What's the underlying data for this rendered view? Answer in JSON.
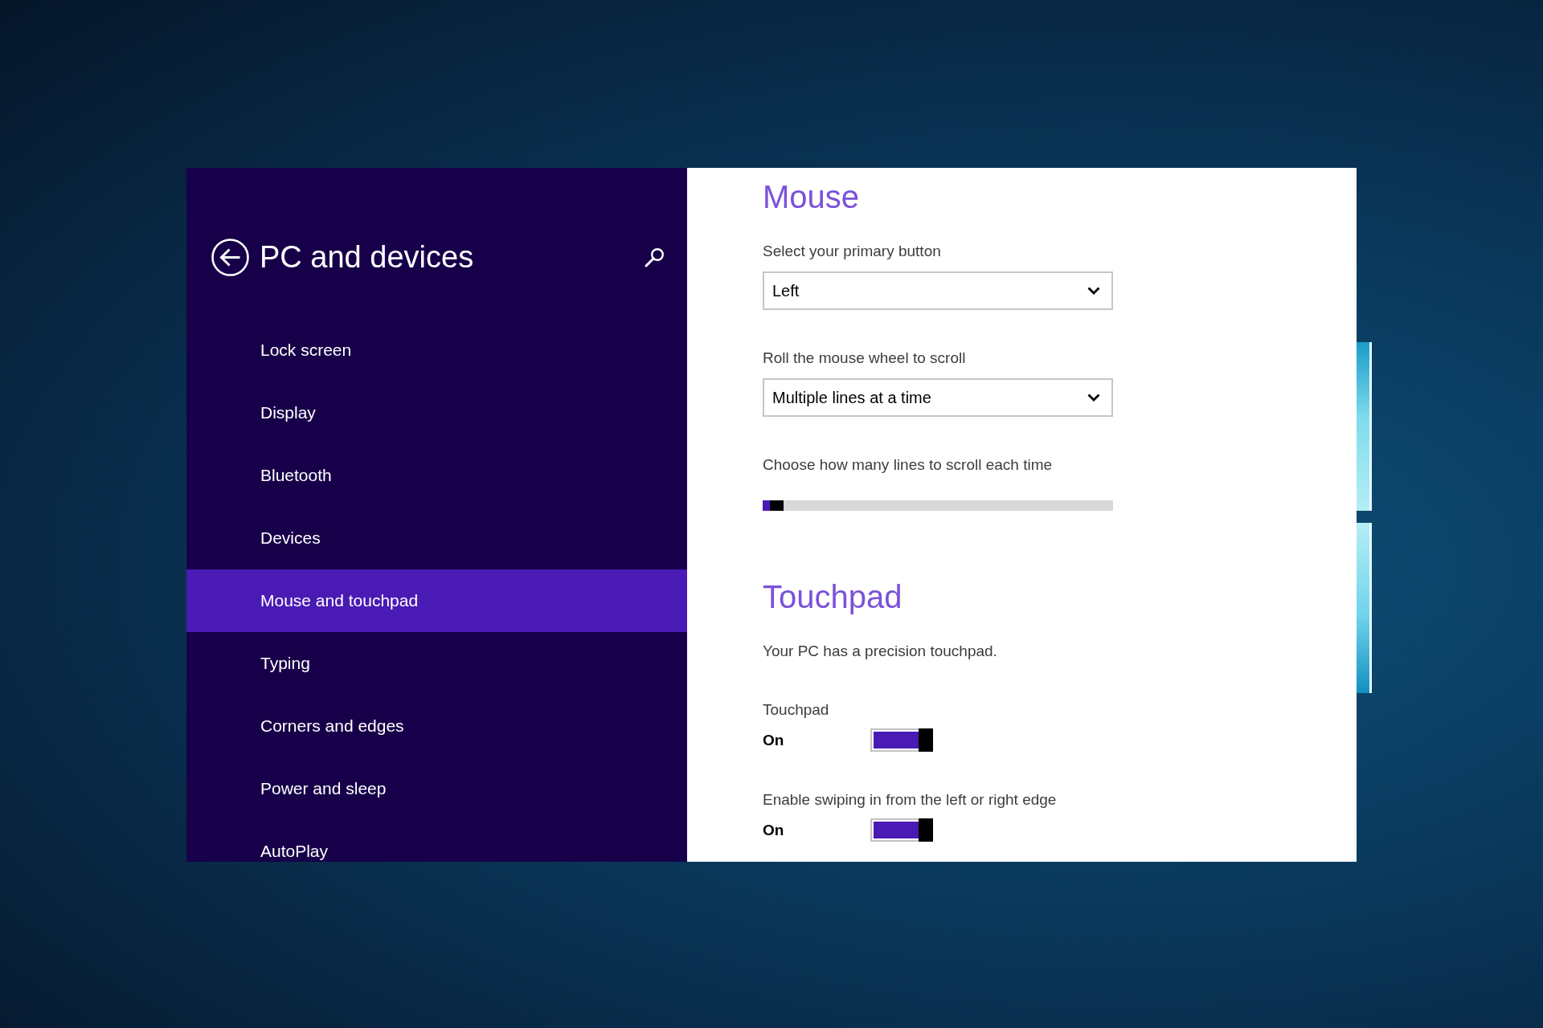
{
  "sidebar": {
    "title": "PC and devices",
    "items": [
      {
        "label": "Lock screen",
        "selected": false
      },
      {
        "label": "Display",
        "selected": false
      },
      {
        "label": "Bluetooth",
        "selected": false
      },
      {
        "label": "Devices",
        "selected": false
      },
      {
        "label": "Mouse and touchpad",
        "selected": true
      },
      {
        "label": "Typing",
        "selected": false
      },
      {
        "label": "Corners and edges",
        "selected": false
      },
      {
        "label": "Power and sleep",
        "selected": false
      },
      {
        "label": "AutoPlay",
        "selected": false
      }
    ]
  },
  "content": {
    "sections": [
      {
        "heading": "Mouse",
        "settings": [
          {
            "kind": "dropdown",
            "label": "Select your primary button",
            "value": "Left"
          },
          {
            "kind": "dropdown",
            "label": "Roll the mouse wheel to scroll",
            "value": "Multiple lines at a time"
          },
          {
            "kind": "slider",
            "label": "Choose how many lines to scroll each time",
            "level": 0.02
          }
        ]
      },
      {
        "heading": "Touchpad",
        "settings": [
          {
            "kind": "text",
            "text": "Your PC has a precision touchpad."
          },
          {
            "kind": "toggle",
            "label": "Touchpad",
            "state_label": "On",
            "on": true
          },
          {
            "kind": "toggle",
            "label": "Enable swiping in from the left or right edge",
            "state_label": "On",
            "on": true
          }
        ]
      }
    ]
  }
}
